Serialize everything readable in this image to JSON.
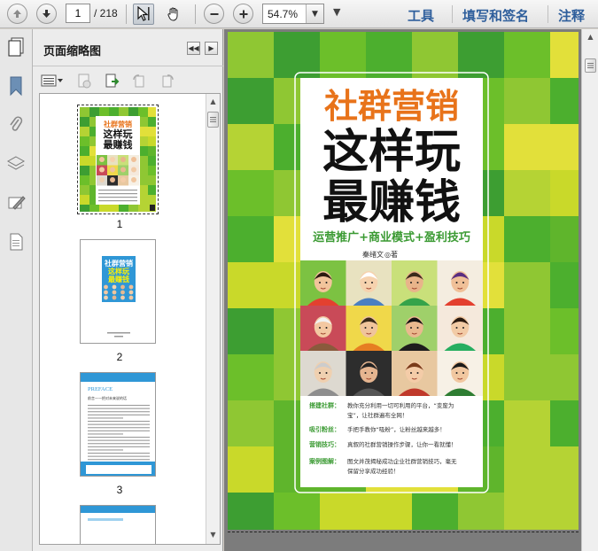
{
  "toolbar": {
    "current_page": "1",
    "page_total": "/ 218",
    "zoom": "54.7%",
    "links": [
      "工具",
      "填写和签名",
      "注释"
    ]
  },
  "panel": {
    "title": "页面缩略图",
    "thumb_labels": [
      "1",
      "2",
      "3"
    ]
  },
  "book": {
    "title_line1": "社群营销",
    "title_line2": "这样玩",
    "title_line3": "最赚钱",
    "subtitle": "运营推广+商业模式+盈利技巧",
    "author": "秦绪文",
    "author_suffix": "◎著",
    "features": [
      {
        "label": "搭建社群：",
        "text1": "教你充分利用一切可利用的平台，“变废为",
        "text2": "宝”，让社群遍布全网！"
      },
      {
        "label": "吸引粉丝：",
        "text1": "手把手教你“吸粉”，让粉丝越来越多！",
        "text2": ""
      },
      {
        "label": "营销技巧：",
        "text1": "真叙的社群营销操作步骤，让你一看就懂！",
        "text2": ""
      },
      {
        "label": "案例图解：",
        "text1": "图文并茂揭秘成功企业社群营销技巧，毫无",
        "text2": "保留分享成功经验！"
      }
    ]
  },
  "thumb2": {
    "title1": "社群营销",
    "title2": "这样玩",
    "title3": "最赚钱"
  },
  "thumb3": {
    "heading": "PREFACE",
    "subheading": "前言——把对未来说的话"
  },
  "colors": {
    "title_orange": "#e8731a",
    "subtitle_green": "#3a9a32",
    "link_blue": "#2f5f9c"
  }
}
